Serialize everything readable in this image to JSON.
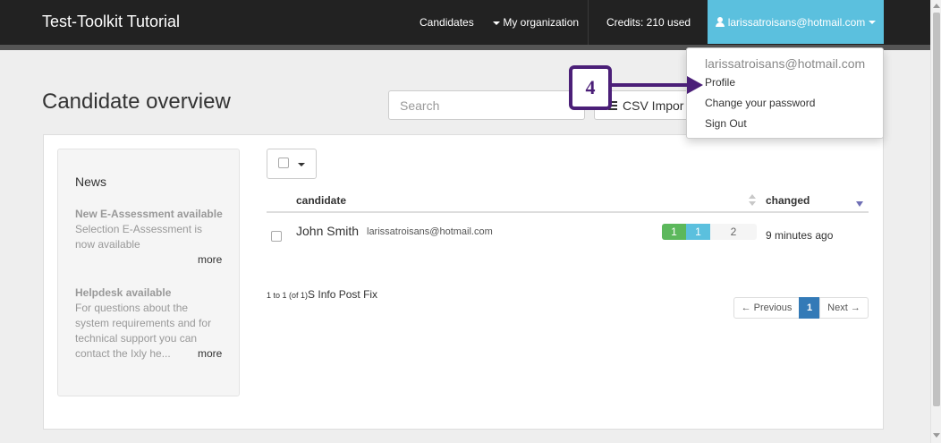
{
  "navbar": {
    "brand": "Test-Toolkit Tutorial",
    "candidates": "Candidates",
    "my_organization": "My organization",
    "credits": "Credits: 210 used",
    "user_email": "larissatroisans@hotmail.com"
  },
  "page": {
    "title": "Candidate overview",
    "search_placeholder": "Search",
    "csv_import": "CSV Impor"
  },
  "news": {
    "title": "News",
    "items": [
      {
        "heading": "New E-Assessment available",
        "body": "Selection E-Assessment is now available",
        "more": "more"
      },
      {
        "heading": "Helpdesk available",
        "body": "For questions about the system requirements and for technical support you can contact the Ixly he...",
        "more": "more"
      }
    ]
  },
  "table": {
    "columns": {
      "candidate": "candidate",
      "changed": "changed"
    },
    "rows": [
      {
        "name": "John Smith",
        "email": "larissatroisans@hotmail.com",
        "progress": [
          "1",
          "1",
          "2"
        ],
        "changed": "9 minutes ago"
      }
    ],
    "pager_info_prefix": "1 to 1 (of 1)",
    "pager_info_suffix": "S Info Post Fix",
    "prev": "← Previous",
    "current": "1",
    "next": "Next →"
  },
  "dropdown": {
    "header": "larissatroisans@hotmail.com",
    "items": [
      "Profile",
      "Change your password",
      "Sign Out"
    ]
  },
  "annotation": {
    "step": "4",
    "color": "#4b1f78"
  },
  "colors": {
    "navbar": "#222222",
    "user_button": "#5bc0de",
    "primary": "#337ab7",
    "success": "#5cb85c"
  }
}
